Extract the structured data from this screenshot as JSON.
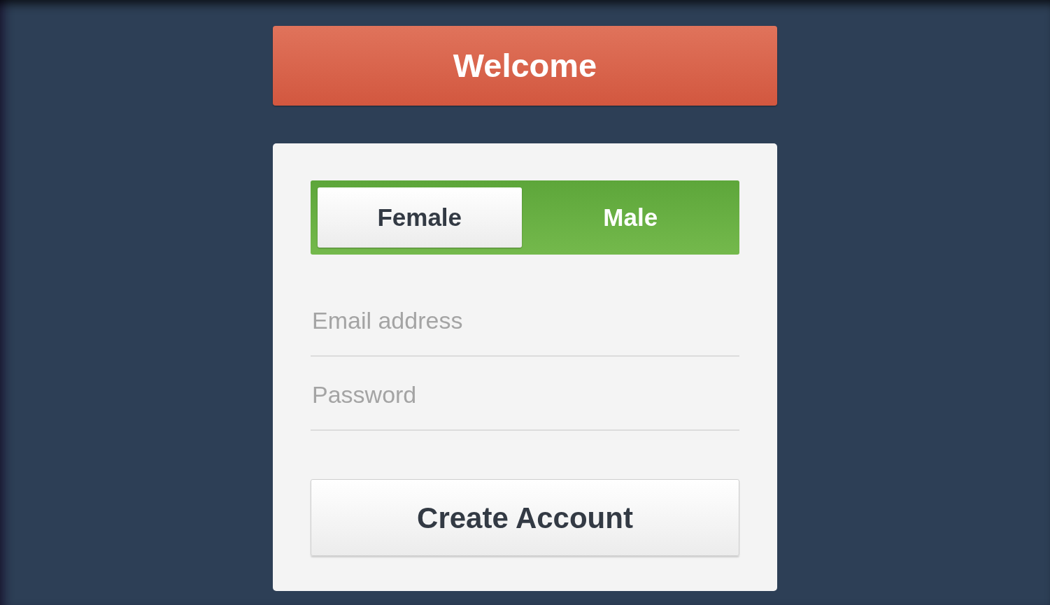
{
  "header": {
    "title": "Welcome"
  },
  "gender_toggle": [
    {
      "label": "Female",
      "selected": true
    },
    {
      "label": "Male",
      "selected": false
    }
  ],
  "fields": [
    {
      "placeholder": "Email address"
    },
    {
      "placeholder": "Password"
    }
  ],
  "submit_button": {
    "label": "Create Account"
  }
}
